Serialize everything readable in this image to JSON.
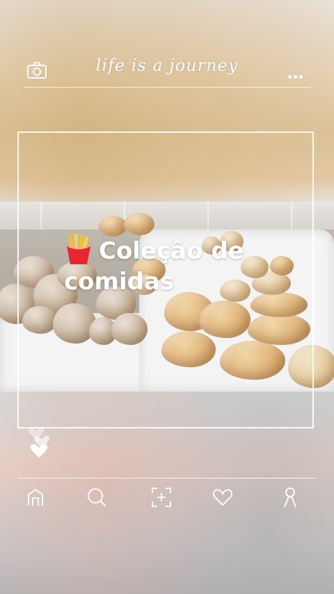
{
  "header": {
    "brand_text": "life is a journey",
    "camera_icon": "camera-icon",
    "more_icon": "more-dots-icon"
  },
  "post": {
    "caption_line1": "Coleção de",
    "caption_line2": "comidas",
    "emoji_icon": "french-fries-icon"
  },
  "reactions": {
    "icon": "hearts-icon"
  },
  "bottom_nav": {
    "items": [
      {
        "name": "home",
        "icon": "home-icon"
      },
      {
        "name": "search",
        "icon": "search-icon"
      },
      {
        "name": "add",
        "icon": "add-post-icon"
      },
      {
        "name": "likes",
        "icon": "heart-icon"
      },
      {
        "name": "profile",
        "icon": "profile-icon"
      }
    ]
  },
  "colors": {
    "line": "#ffffff",
    "caption": "#ffffff",
    "fries_red": "#e8262d",
    "fries_yellow": "#f7c21d"
  }
}
